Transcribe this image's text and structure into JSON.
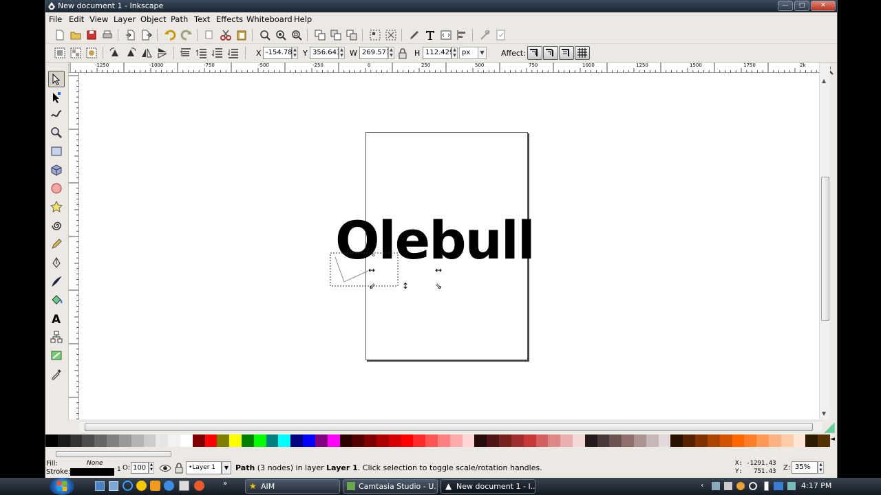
{
  "window": {
    "title": "New document 1 - Inkscape"
  },
  "menu": [
    "File",
    "Edit",
    "View",
    "Layer",
    "Object",
    "Path",
    "Text",
    "Effects",
    "Whiteboard",
    "Help"
  ],
  "selectbar": {
    "x_label": "X",
    "x_value": "-154.786",
    "y_label": "Y",
    "y_value": "356.643",
    "w_label": "W",
    "w_value": "269.571",
    "h_label": "H",
    "h_value": "112.429",
    "unit": "px",
    "affect_label": "Affect:"
  },
  "ruler": {
    "h_ticks": [
      "-1250",
      "-1000",
      "-750",
      "-500",
      "-250",
      "0",
      "250",
      "500",
      "750",
      "1000",
      "1250",
      "1500",
      "1750",
      "2k"
    ]
  },
  "canvas": {
    "text": "Olebull"
  },
  "status": {
    "fill_label": "Fill:",
    "fill_value": "None",
    "stroke_label": "Stroke:",
    "stroke_width": "1",
    "opacity_label": "O:",
    "opacity_value": "100",
    "layer": "Layer 1",
    "message_prefix": "Path",
    "message_mid": " (3 nodes) in layer ",
    "message_layer": "Layer 1",
    "message_suffix": ". Click selection to toggle scale/rotation handles.",
    "cursor_x": "X: -1291.43",
    "cursor_y": "Y:   751.43",
    "zoom_label": "Z:",
    "zoom_value": "35%"
  },
  "palette_colors": [
    "#000000",
    "#1a1a1a",
    "#333333",
    "#4d4d4d",
    "#666666",
    "#808080",
    "#999999",
    "#b3b3b3",
    "#cccccc",
    "#e6e6e6",
    "#f2f2f2",
    "#ffffff",
    "#800000",
    "#ff0000",
    "#808000",
    "#ffff00",
    "#008000",
    "#00ff00",
    "#008080",
    "#00ffff",
    "#000080",
    "#0000ff",
    "#800080",
    "#ff00ff",
    "#2b0000",
    "#550000",
    "#800000",
    "#aa0000",
    "#d40000",
    "#ff0000",
    "#ff2a2a",
    "#ff5555",
    "#ff8080",
    "#ffaaaa",
    "#ffd5d5",
    "#280b0b",
    "#501616",
    "#782121",
    "#a02c2c",
    "#c83737",
    "#d35f5f",
    "#de8787",
    "#e9afaf",
    "#f4d7d7",
    "#241c1c",
    "#483737",
    "#6c5353",
    "#916f6f",
    "#ac9393",
    "#c8b7b7",
    "#e3dbdb",
    "#2b1100",
    "#552200",
    "#803300",
    "#aa4400",
    "#d45500",
    "#ff6600",
    "#ff7f2a",
    "#ff9955",
    "#ffb380",
    "#ffccaa",
    "#ffe6d5",
    "#2b1c00",
    "#553300"
  ],
  "taskbar": {
    "items": [
      "AIM",
      "Camtasia Studio - U...",
      "New document 1 - I..."
    ],
    "clock": "4:17 PM"
  }
}
